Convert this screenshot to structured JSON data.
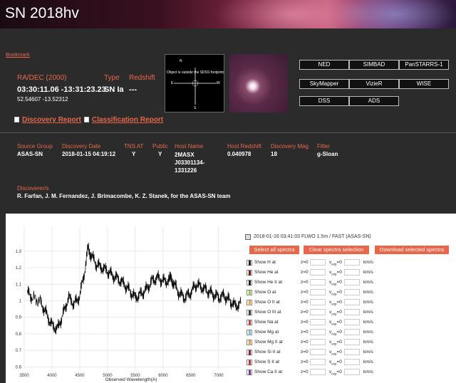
{
  "title": "SN 2018hv",
  "bookmark": "Bookmark",
  "radec": {
    "label": "RA/DEC (2000)",
    "sexagesimal": "03:30:11.06 -13:31:23.23",
    "degrees": "52.54607 -13.52312"
  },
  "type": {
    "label": "Type",
    "value": "SN Ia"
  },
  "redshift": {
    "label": "Redshift",
    "value": "---"
  },
  "finder": {
    "note": "Object is outside the SDSS footprint",
    "n": "N",
    "e": "E",
    "w": "W",
    "s": "S"
  },
  "links": {
    "discovery": "Discovery Report",
    "classification": "Classification Report"
  },
  "buttons": [
    "NED",
    "SIMBAD",
    "PanSTARRS-1",
    "SkyMapper",
    "VizieR",
    "WISE",
    "DSS",
    "ADS"
  ],
  "details": {
    "source_group": {
      "label": "Source Group",
      "value": "ASAS-SN"
    },
    "discovery_date": {
      "label": "Discovery Date",
      "value": "2018-01-15 04:19:12"
    },
    "tns_at": {
      "label": "TNS AT",
      "value": "Y"
    },
    "public": {
      "label": "Public",
      "value": "Y"
    },
    "host_name": {
      "label": "Host Name",
      "value": "2MASX J03301134-1331226"
    },
    "host_redshift": {
      "label": "Host Redshift",
      "value": "0.040978"
    },
    "discovery_mag": {
      "label": "Discovery Mag",
      "value": "18"
    },
    "filter": {
      "label": "Filter",
      "value": "g-Sloan"
    }
  },
  "discoverers": {
    "label": "Discoverer/s",
    "value": "R. Farfan, J. M. Fernandez, J. Brimacombe, K. Z. Stanek, for the ASAS-SN team"
  },
  "spectra": {
    "entry": "2018-01-16 03:41:03 FLWO 1.5m / FAST (ASAS-SN)",
    "select_all": "Select all spectra",
    "clear": "Clear spectra selection",
    "download": "Download selected spectra"
  },
  "lines": [
    {
      "label": "Show H at",
      "color": "#222222"
    },
    {
      "label": "Show He at",
      "color": "#7a1414"
    },
    {
      "label": "Show He II at",
      "color": "#222222"
    },
    {
      "label": "Show O at",
      "color": "#88cc44"
    },
    {
      "label": "Show O II at",
      "color": "#e8a43a"
    },
    {
      "label": "Show O III at",
      "color": "#3a3a3a"
    },
    {
      "label": "Show Na at",
      "color": "#d23a3a"
    },
    {
      "label": "Show Mg at",
      "color": "#7ab8e0"
    },
    {
      "label": "Show Mg II at",
      "color": "#e89a4a"
    },
    {
      "label": "Show Si II at",
      "color": "#9a1a3a"
    },
    {
      "label": "Show S II at",
      "color": "#c23030"
    },
    {
      "label": "Show Ca II at",
      "color": "#6a3aa0"
    }
  ],
  "line_form": {
    "z": "z=0",
    "v": "v",
    "v_sub": "exp",
    "v_eq": "=0",
    "kms": "km/s"
  },
  "chart_data": {
    "type": "line",
    "xlabel": "Observed Wavelength(A)",
    "ylabel": "",
    "xlim": [
      3500,
      7400
    ],
    "ylim": [
      0.58,
      1.45
    ],
    "xticks": [
      3500,
      4000,
      4500,
      5000,
      5500,
      6000,
      6500,
      7000
    ],
    "yticks": [
      0.6,
      0.7,
      0.8,
      0.9,
      1.0,
      1.1,
      1.2,
      1.3
    ],
    "ytick_labels": [
      "0.6",
      "0.7",
      "0.8",
      "0.9",
      "1",
      "1.1",
      "1.2",
      "1.3"
    ],
    "series": [
      {
        "x": [
          3550,
          3650,
          3800,
          3900,
          4000,
          4100,
          4200,
          4300,
          4400,
          4500,
          4600,
          4650,
          4700,
          4800,
          4900,
          5000,
          5100,
          5200,
          5300,
          5400,
          5500,
          5600,
          5700,
          5800,
          5900,
          6000,
          6100,
          6150,
          6200,
          6300,
          6400,
          6500,
          6600,
          6700,
          6800,
          6900,
          7000,
          7100,
          7200,
          7300,
          7400
        ],
        "y": [
          1.05,
          1.02,
          0.99,
          0.92,
          0.85,
          0.83,
          0.92,
          1.02,
          0.98,
          1.03,
          1.2,
          1.32,
          1.28,
          1.22,
          1.2,
          1.18,
          1.15,
          1.13,
          1.1,
          1.06,
          1.02,
          1.04,
          1.07,
          1.12,
          1.14,
          1.12,
          1.12,
          1.14,
          1.1,
          1.04,
          1.02,
          1.05,
          1.1,
          1.08,
          1.06,
          1.04,
          1.02,
          1.03,
          1.0,
          0.97,
          0.98
        ]
      }
    ]
  }
}
